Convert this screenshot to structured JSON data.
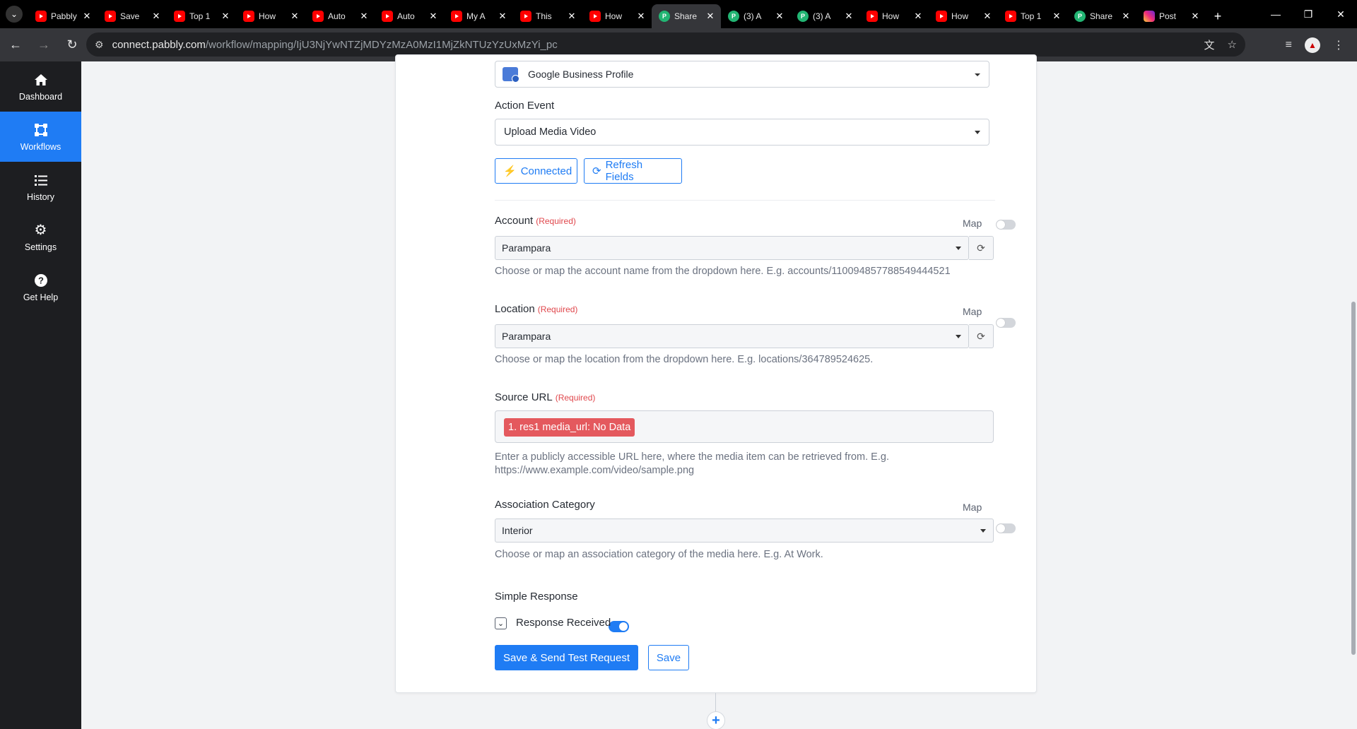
{
  "browser": {
    "tabs": [
      {
        "title": "Pabbly",
        "icon": "youtube-icon",
        "active": false
      },
      {
        "title": "Save",
        "icon": "youtube-icon",
        "active": false
      },
      {
        "title": "Top 1",
        "icon": "youtube-icon",
        "active": false
      },
      {
        "title": "How",
        "icon": "youtube-icon",
        "active": false
      },
      {
        "title": "Auto",
        "icon": "youtube-icon",
        "active": false
      },
      {
        "title": "Auto",
        "icon": "youtube-icon",
        "active": false
      },
      {
        "title": "My A",
        "icon": "youtube-icon",
        "active": false
      },
      {
        "title": "This",
        "icon": "youtube-icon",
        "active": false
      },
      {
        "title": "How",
        "icon": "youtube-icon",
        "active": false
      },
      {
        "title": "Share",
        "icon": "pabbly-icon",
        "active": true
      },
      {
        "title": "(3) A",
        "icon": "pabbly-icon",
        "active": false
      },
      {
        "title": "(3) A",
        "icon": "pabbly-icon",
        "active": false
      },
      {
        "title": "How",
        "icon": "youtube-icon",
        "active": false
      },
      {
        "title": "How",
        "icon": "youtube-icon",
        "active": false
      },
      {
        "title": "Top 1",
        "icon": "youtube-icon",
        "active": false
      },
      {
        "title": "Share",
        "icon": "pabbly-icon",
        "active": false
      },
      {
        "title": "Post",
        "icon": "instagram-icon",
        "active": false
      }
    ],
    "url_host": "connect.pabbly.com",
    "url_path": "/workflow/mapping/IjU3NjYwNTZjMDYzMzA0MzI1MjZkNTUzYzUxMzYi_pc"
  },
  "sidebar": {
    "items": [
      {
        "label": "Dashboard",
        "icon": "home-icon",
        "active": false
      },
      {
        "label": "Workflows",
        "icon": "workflow-icon",
        "active": true
      },
      {
        "label": "History",
        "icon": "list-icon",
        "active": false
      },
      {
        "label": "Settings",
        "icon": "gear-icon",
        "active": false
      },
      {
        "label": "Get Help",
        "icon": "question-icon",
        "active": false
      }
    ]
  },
  "form": {
    "app_value": "Google Business Profile",
    "action_event_label": "Action Event",
    "action_event_value": "Upload Media Video",
    "connected_label": "Connected",
    "refresh_fields_label": "Refresh Fields",
    "required_text": "(Required)",
    "map_label": "Map",
    "account": {
      "label": "Account",
      "value": "Parampara",
      "help": "Choose or map the account name from the dropdown here. E.g. accounts/110094857788549444521"
    },
    "location": {
      "label": "Location",
      "value": "Parampara",
      "help": "Choose or map the location from the dropdown here. E.g. locations/364789524625."
    },
    "source_url": {
      "label": "Source URL",
      "token": "1. res1 media_url: No Data",
      "help_line1": "Enter a publicly accessible URL here, where the media item can be retrieved from. E.g.",
      "help_line2": "https://www.example.com/video/sample.png"
    },
    "association_category": {
      "label": "Association Category",
      "value": "Interior",
      "help": "Choose or map an association category of the media here. E.g. At Work."
    },
    "simple_response_label": "Simple Response",
    "response_received_label": "Response Received",
    "save_send_label": "Save & Send Test Request",
    "save_label": "Save"
  },
  "colors": {
    "accent": "#1f7cf4",
    "required": "#e0474c",
    "token_bg": "#e4595e",
    "sidebar_bg": "#1d1e21"
  }
}
